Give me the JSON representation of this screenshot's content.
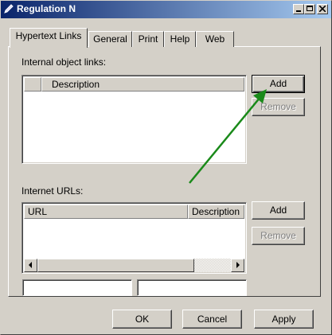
{
  "window": {
    "title": "Regulation N",
    "title_icon": "pen-icon",
    "controls": [
      "minimize",
      "maximize",
      "close"
    ]
  },
  "tabs": [
    {
      "label": "Hypertext Links",
      "active": true
    },
    {
      "label": "General",
      "active": false
    },
    {
      "label": "Print",
      "active": false
    },
    {
      "label": "Help",
      "active": false
    },
    {
      "label": "Web",
      "active": false
    }
  ],
  "internal": {
    "label": "Internal object links:",
    "columns": [
      "",
      "Description"
    ],
    "add_label": "Add",
    "remove_label": "Remove"
  },
  "internet": {
    "label": "Internet URLs:",
    "columns": [
      "URL",
      "Description"
    ],
    "add_label": "Add",
    "remove_label": "Remove",
    "field1_value": "",
    "field2_value": ""
  },
  "footer": {
    "ok_label": "OK",
    "cancel_label": "Cancel",
    "apply_label": "Apply"
  },
  "annotation": {
    "arrow_color": "#1a8a1a"
  }
}
